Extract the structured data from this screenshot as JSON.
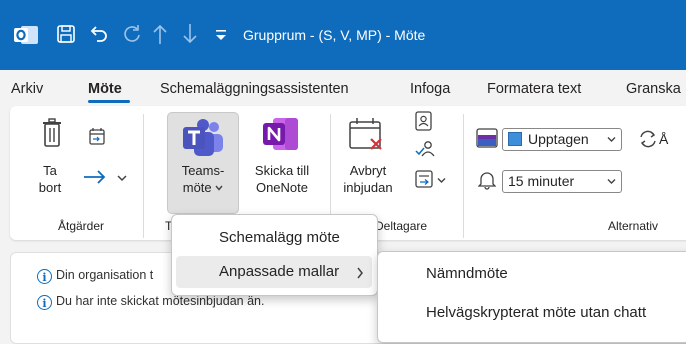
{
  "titlebar": {
    "title": "Grupprum - (S, V, MP)  -  Möte"
  },
  "tabs": [
    "Arkiv",
    "Möte",
    "Schemaläggningsassistenten",
    "Infoga",
    "Formatera text",
    "Granska"
  ],
  "ribbon": {
    "delete_label_1": "Ta",
    "delete_label_2": "bort",
    "teams_label_1": "Teams-",
    "teams_label_2": "möte",
    "onenote_label_1": "Skicka till",
    "onenote_label_2": "OneNote",
    "cancel_label_1": "Avbryt",
    "cancel_label_2": "inbjudan",
    "group_actions": "Åtgärder",
    "group_teams_partial": "Te",
    "group_attendees": "Deltagare",
    "group_options": "Alternativ",
    "status_value": "Upptagen",
    "reminder_value": "15 minuter",
    "partial_btn": "Å"
  },
  "info": {
    "line1": "Din organisation t",
    "line2": "Du har inte skickat mötesinbjudan än."
  },
  "menu": {
    "item1": "Schemalägg möte",
    "item2": "Anpassade mallar",
    "submenu_item1": "Nämndmöte",
    "submenu_item2": "Helvägskrypterat möte utan chatt"
  }
}
